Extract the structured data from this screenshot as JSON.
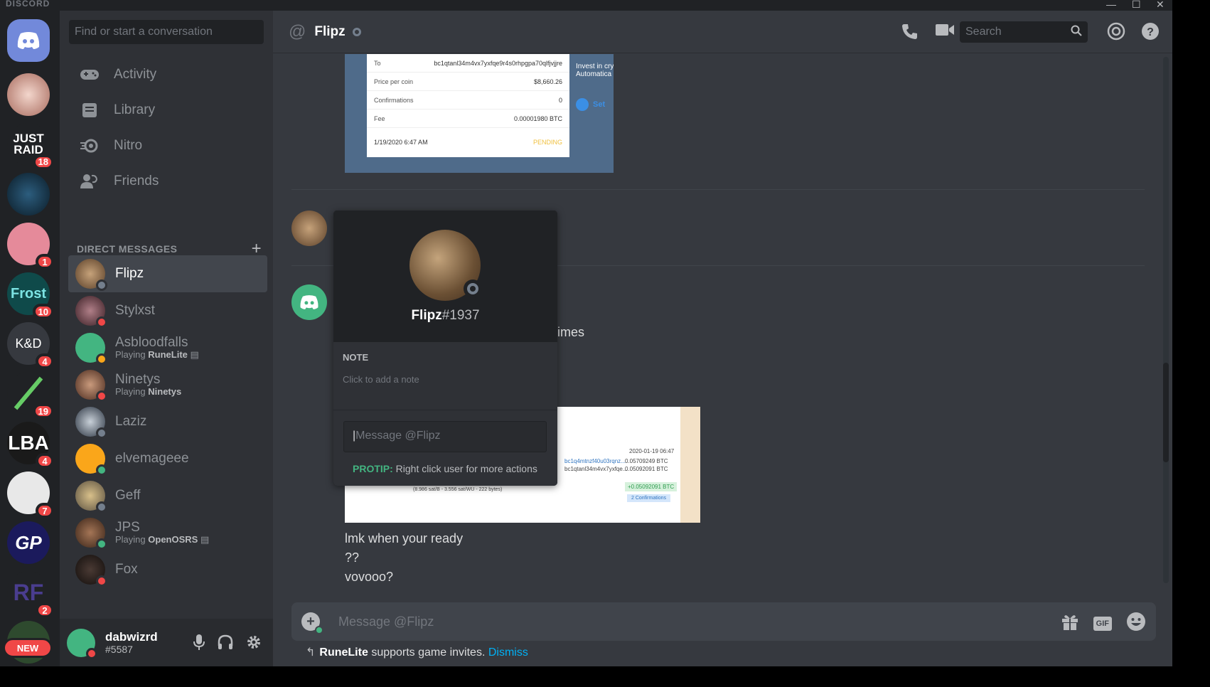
{
  "window": {
    "brand": "DISCORD"
  },
  "servers": [
    {
      "label": "",
      "badge": ""
    },
    {
      "label": "JUST RAID",
      "badge": "18"
    },
    {
      "label": "",
      "badge": ""
    },
    {
      "label": "",
      "badge": "1"
    },
    {
      "label": "Frost",
      "badge": "10"
    },
    {
      "label": "K&D",
      "badge": "4"
    },
    {
      "label": "",
      "badge": "19"
    },
    {
      "label": "LBA",
      "badge": "4"
    },
    {
      "label": "",
      "badge": "7"
    },
    {
      "label": "GP",
      "badge": ""
    },
    {
      "label": "RF",
      "badge": "2"
    }
  ],
  "new_badge": "NEW",
  "sidebar": {
    "search_placeholder": "Find or start a conversation",
    "nav": [
      {
        "label": "Activity",
        "icon": "gamepad-icon"
      },
      {
        "label": "Library",
        "icon": "library-icon"
      },
      {
        "label": "Nitro",
        "icon": "nitro-icon"
      },
      {
        "label": "Friends",
        "icon": "friends-icon"
      }
    ],
    "dm_header": "DIRECT MESSAGES",
    "dms": [
      {
        "name": "Flipz",
        "sub_prefix": "",
        "sub_game": "",
        "status": "offline",
        "color": "#8b6a48"
      },
      {
        "name": "Stylxst",
        "sub_prefix": "",
        "sub_game": "",
        "status": "dnd",
        "color": "#5a2e3b"
      },
      {
        "name": "Asbloodfalls",
        "sub_prefix": "Playing",
        "sub_game": "RuneLite",
        "status": "idle",
        "color": "#43b581"
      },
      {
        "name": "Ninetys",
        "sub_prefix": "Playing",
        "sub_game": "Ninetys",
        "status": "dnd",
        "color": "#7a4a3a"
      },
      {
        "name": "Laziz",
        "sub_prefix": "",
        "sub_game": "",
        "status": "offline",
        "color": "#4d5a66"
      },
      {
        "name": "elvemageee",
        "sub_prefix": "",
        "sub_game": "",
        "status": "online",
        "color": "#faa61a"
      },
      {
        "name": "Geff",
        "sub_prefix": "",
        "sub_game": "",
        "status": "offline",
        "color": "#9a8f7c"
      },
      {
        "name": "JPS",
        "sub_prefix": "Playing",
        "sub_game": "OpenOSRS",
        "status": "online",
        "color": "#6b4a35"
      },
      {
        "name": "Fox",
        "sub_prefix": "",
        "sub_game": "",
        "status": "dnd",
        "color": "#2a2220"
      }
    ],
    "user": {
      "name": "dabwizrd",
      "tag": "#5587"
    }
  },
  "chat": {
    "title": "Flipz",
    "search_placeholder": "Search",
    "receipt": {
      "rows": [
        {
          "k": "To",
          "v": "bc1qtanl34m4vx7yxfqe9r4s0rhpgpa70qlfjvjjre"
        },
        {
          "k": "Price per coin",
          "v": "$8,660.26"
        },
        {
          "k": "Confirmations",
          "v": "0"
        },
        {
          "k": "Fee",
          "v": "0.00001980 BTC"
        }
      ],
      "date": "1/19/2020 6:47 AM",
      "status": "PENDING",
      "side_text": "Invest in cry Automatica",
      "side_link": "Set"
    },
    "messages": [
      "times",
      "lmk when your ready",
      "??",
      "vovooo?"
    ],
    "tx": {
      "date": "2020-01-19 06:47",
      "addr1": "bc1q4mtnzf40u03rqnz...",
      "amt1": "0.05709249 BTC",
      "addr2": "bc1qtanl34m4vx7yxfqe...",
      "amt2": "0.05092091 BTC",
      "fee_line": "(8.986 sat/B - 3.556 sat/WU - 222 bytes)",
      "plus": "+0.05092091 BTC",
      "confirmations": "2 Confirmations"
    },
    "composer_placeholder": "Message @Flipz",
    "notice": {
      "app": "RuneLite",
      "text": "supports game invites.",
      "dismiss": "Dismiss"
    },
    "gif_label": "GIF"
  },
  "popout": {
    "username": "Flipz",
    "discriminator": "#1937",
    "note_label": "NOTE",
    "note_placeholder": "Click to add a note",
    "message_placeholder": "Message @Flipz",
    "protip_label": "PROTIP:",
    "protip_text": "Right click user for more actions"
  }
}
